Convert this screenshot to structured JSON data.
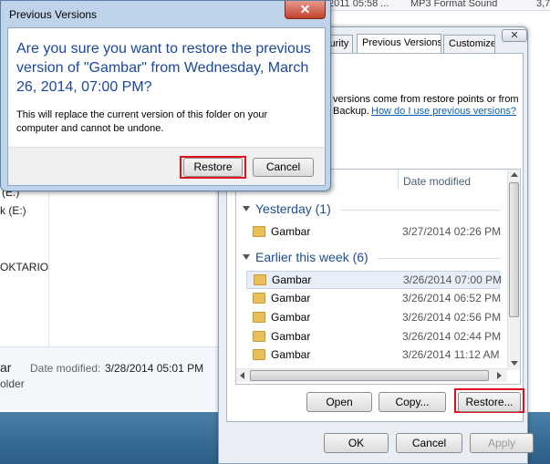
{
  "explorer": {
    "top_fragments": [
      "2011 05:58 ...",
      "MP3 Format Sound",
      "3,7"
    ],
    "nav_items": [
      "(E:)",
      "k (E:)",
      "OKTARIO"
    ],
    "details": {
      "name": "ar",
      "date_modified_label": "Date modified:",
      "date_modified_value": "3/28/2014 05:01 PM",
      "type": "older"
    }
  },
  "properties": {
    "tabs": [
      "curity",
      "Previous Versions",
      "Customize"
    ],
    "active_tab": "Previous Versions",
    "intro_line1": "versions come from restore points or from",
    "intro_line2": "Backup.",
    "help_link": "How do I use previous versions?",
    "list": {
      "column_date": "Date modified",
      "groups": [
        {
          "label": "Yesterday (1)",
          "items": [
            {
              "name": "Gambar",
              "date": "3/27/2014 02:26 PM"
            }
          ]
        },
        {
          "label": "Earlier this week (6)",
          "items": [
            {
              "name": "Gambar",
              "date": "3/26/2014 07:00 PM",
              "selected": true
            },
            {
              "name": "Gambar",
              "date": "3/26/2014 06:52 PM"
            },
            {
              "name": "Gambar",
              "date": "3/26/2014 02:56 PM"
            },
            {
              "name": "Gambar",
              "date": "3/26/2014 02:44 PM"
            },
            {
              "name": "Gambar",
              "date": "3/26/2014 11:12 AM"
            }
          ]
        }
      ]
    },
    "buttons": {
      "open": "Open",
      "copy": "Copy...",
      "restore": "Restore..."
    },
    "footer_buttons": {
      "ok": "OK",
      "cancel": "Cancel",
      "apply": "Apply"
    }
  },
  "dialog": {
    "title": "Previous Versions",
    "close_glyph": "✕",
    "heading": "Are you sure you want to restore the previous version of \"Gambar\" from Wednesday, March 26, 2014, 07:00 PM?",
    "message": "This will replace the current version of this folder on your computer and cannot be undone.",
    "restore_label": "Restore",
    "cancel_label": "Cancel"
  },
  "colors": {
    "highlight_box": "#e0101e",
    "heading_blue": "#1a47a3",
    "link_blue": "#0a5fb5"
  }
}
